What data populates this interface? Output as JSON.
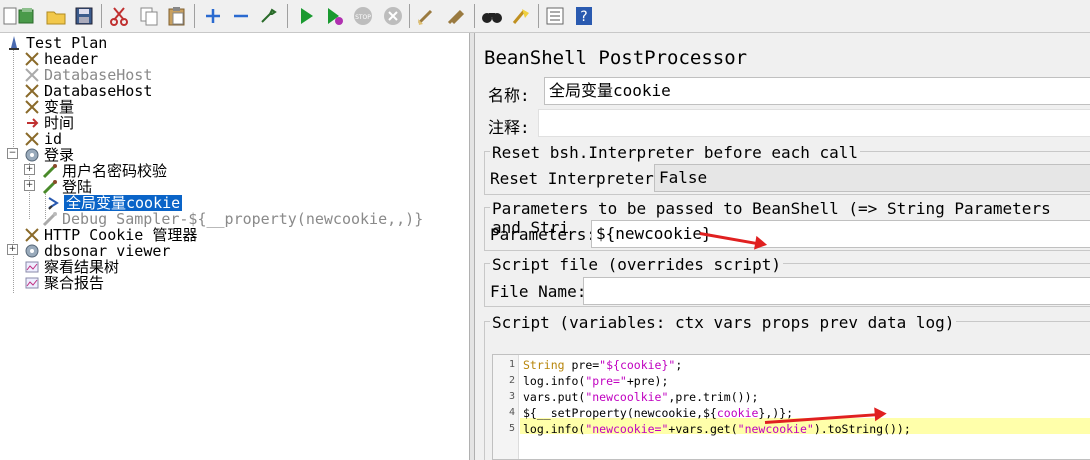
{
  "toolbar": {
    "buttons": [
      "new-icon",
      "templates-icon",
      "open-icon",
      "save-icon",
      "cut-icon",
      "copy-icon",
      "paste-icon",
      "expand-icon",
      "collapse-icon",
      "toggle-icon",
      "start-icon",
      "start-no-pause-icon",
      "stop-icon",
      "shutdown-icon",
      "clear-icon",
      "clear-all-icon",
      "search-icon",
      "reset-search-icon",
      "function-helper-icon",
      "help-icon"
    ]
  },
  "tree": {
    "nodes": [
      {
        "label": "Test Plan"
      },
      {
        "label": "header"
      },
      {
        "label": "DatabaseHost"
      },
      {
        "label": "DatabaseHost"
      },
      {
        "label": "变量"
      },
      {
        "label": "时间"
      },
      {
        "label": "id"
      },
      {
        "label": "登录"
      },
      {
        "label": "用户名密码校验"
      },
      {
        "label": "登陆"
      },
      {
        "label": "全局变量cookie"
      },
      {
        "label": "Debug Sampler-${__property(newcookie,,)}"
      },
      {
        "label": "HTTP Cookie 管理器"
      },
      {
        "label": "dbsonar viewer"
      },
      {
        "label": "察看结果树"
      },
      {
        "label": "聚合报告"
      }
    ]
  },
  "panel": {
    "title": "BeanShell PostProcessor",
    "name_label": "名称:",
    "name_value": "全局变量cookie",
    "comment_label": "注释:",
    "comment_value": "",
    "reset_group_title": "Reset bsh.Interpreter before each call",
    "reset_label": "Reset Interpreter:",
    "reset_value": "False",
    "params_group_title": "Parameters to be passed to BeanShell (=> String Parameters and Stri",
    "params_label": "Parameters:",
    "params_value": "${newcookie}",
    "file_group_title": "Script file (overrides script)",
    "file_label": "File Name:",
    "file_value": "",
    "script_group_title": "Script (variables: ctx vars props prev data log)"
  },
  "script": {
    "line_numbers": [
      "1",
      "2",
      "3",
      "4",
      "5"
    ],
    "lines": [
      {
        "parts": [
          {
            "t": "String",
            "c": "kw"
          },
          {
            "t": " pre=",
            "c": ""
          },
          {
            "t": "\"${cookie}\"",
            "c": "str"
          },
          {
            "t": ";",
            "c": ""
          }
        ]
      },
      {
        "parts": [
          {
            "t": "log.info(",
            "c": ""
          },
          {
            "t": "\"pre=\"",
            "c": "str"
          },
          {
            "t": "+pre);",
            "c": ""
          }
        ]
      },
      {
        "parts": [
          {
            "t": "vars.put(",
            "c": ""
          },
          {
            "t": "\"newcoolkie\"",
            "c": "str"
          },
          {
            "t": ",pre.trim());",
            "c": ""
          }
        ]
      },
      {
        "parts": [
          {
            "t": "${__setProperty(newcookie,${",
            "c": ""
          },
          {
            "t": "cookie",
            "c": "str"
          },
          {
            "t": "},)};",
            "c": ""
          }
        ]
      },
      {
        "parts": [
          {
            "t": "log.info(",
            "c": ""
          },
          {
            "t": "\"newcookie=\"",
            "c": "str"
          },
          {
            "t": "+vars.get(",
            "c": ""
          },
          {
            "t": "\"newcookie\"",
            "c": "str"
          },
          {
            "t": ").toString());",
            "c": ""
          }
        ]
      }
    ]
  },
  "colors": {
    "selection": "#0a64c8",
    "annotation_arrow": "#e02020",
    "highlight_line": "#ffffaa"
  }
}
